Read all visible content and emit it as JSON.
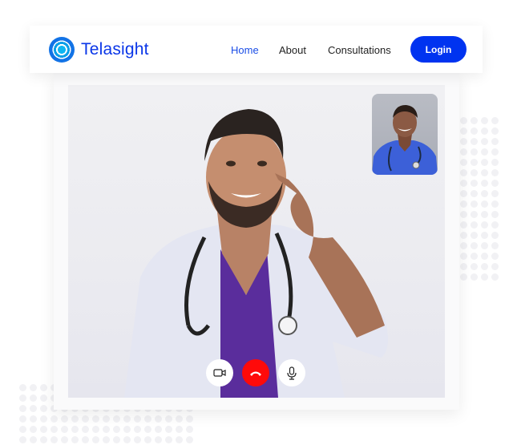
{
  "brand": {
    "name": "Telasight",
    "logo_icon": "concentric-circle-logo-icon",
    "color": "#0a36e8"
  },
  "nav": {
    "links": [
      {
        "label": "Home",
        "active": true
      },
      {
        "label": "About",
        "active": false
      },
      {
        "label": "Consultations",
        "active": false
      }
    ],
    "login_label": "Login",
    "login_color": "#0033f0"
  },
  "call": {
    "main_video": "doctor in white coat and purple scrubs pointing at cheek",
    "self_view": "smiling man in blue scrubs with stethoscope",
    "controls": [
      {
        "name": "camera",
        "icon": "video-camera-icon"
      },
      {
        "name": "end-call",
        "icon": "phone-hangup-icon",
        "color": "#ff0a0a"
      },
      {
        "name": "microphone",
        "icon": "microphone-icon"
      }
    ]
  }
}
